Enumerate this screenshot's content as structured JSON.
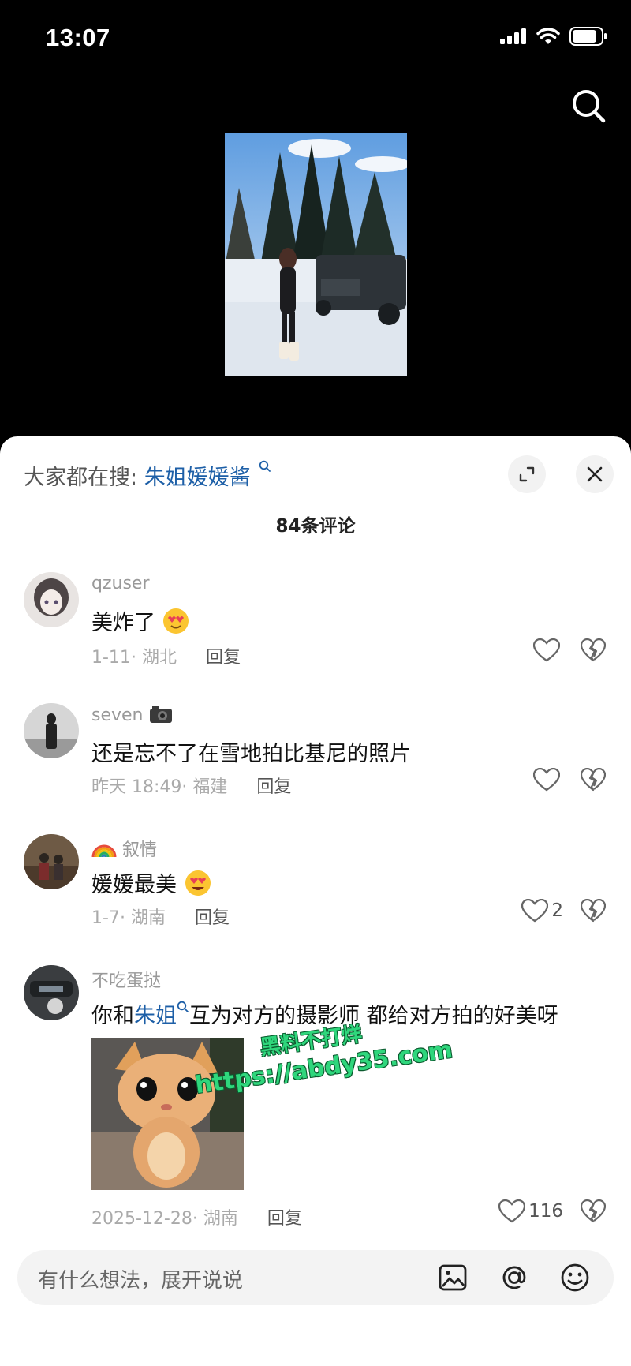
{
  "status": {
    "time": "13:07"
  },
  "trending": {
    "prefix": "大家都在搜:",
    "term": "朱姐媛媛酱"
  },
  "comments_header": {
    "count_label": "84条评论"
  },
  "comments": [
    {
      "user": "qzuser",
      "text": "美炸了",
      "emoji": "heart-eyes-kiss-emoji",
      "date": "1-11",
      "location": "湖北",
      "reply": "回复",
      "likes": ""
    },
    {
      "user": "seven",
      "user_emoji": "camera-emoji",
      "text": "还是忘不了在雪地拍比基尼的照片",
      "date": "昨天 18:49",
      "location": "福建",
      "reply": "回复",
      "likes": ""
    },
    {
      "user": "叙情",
      "user_emoji": "rainbow-emoji",
      "text": "媛媛最美",
      "emoji": "star-struck-emoji",
      "date": "1-7",
      "location": "湖南",
      "reply": "回复",
      "likes": "2"
    },
    {
      "user": "不吃蛋挞",
      "text_before": "你和",
      "text_link": "朱姐",
      "text_after": "互为对方的摄影师 都给对方拍的好美呀",
      "date": "2025-12-28",
      "location": "湖南",
      "reply": "回复",
      "likes": "116"
    }
  ],
  "watermark": {
    "line1": "黑料不打烊",
    "line2": "https://abdy35.com"
  },
  "input": {
    "placeholder": "有什么想法，展开说说"
  },
  "colors": {
    "link": "#1d5fa7",
    "watermark": "#2fd67c",
    "sheet": "#ffffff",
    "background": "#000000"
  }
}
